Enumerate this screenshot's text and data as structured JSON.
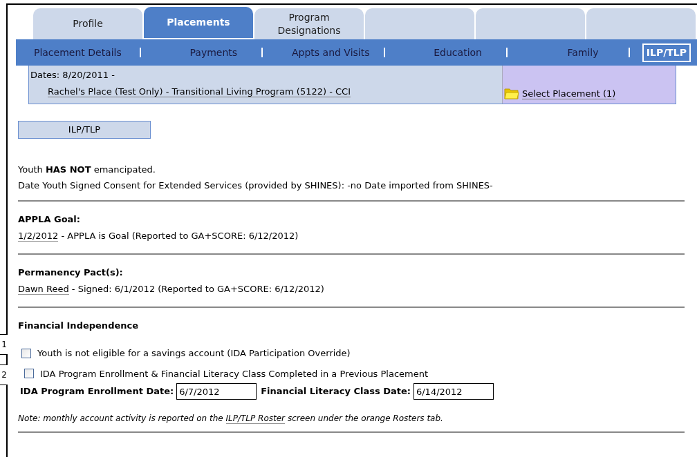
{
  "tabs": [
    {
      "label": "Profile",
      "selected": false
    },
    {
      "label": "Placements",
      "selected": true
    },
    {
      "label": "Program Designations",
      "selected": false
    },
    {
      "selected": false
    },
    {
      "selected": false
    },
    {
      "selected": false
    }
  ],
  "subnav": [
    {
      "label": "Placement Details",
      "selected": false
    },
    {
      "label": "Payments",
      "selected": false
    },
    {
      "label": "Appts and Visits",
      "selected": false
    },
    {
      "label": "Education",
      "selected": false
    },
    {
      "label": "Family",
      "selected": false
    },
    {
      "label": "ILP/TLP",
      "selected": true
    }
  ],
  "placement": {
    "dates": "Dates: 8/20/2011 -",
    "name": "Rachel's Place (Test Only) - Transitional Living Program (5122) - CCI",
    "select_link": "Select Placement (1)"
  },
  "section_button": "ILP/TLP",
  "emancipation": "Youth **HAS NOT** emancipated.",
  "consent": "Date Youth Signed Consent for Extended Services (provided by SHINES): -no Date imported from SHINES-",
  "appla": {
    "heading": "APPLA Goal:",
    "link": "1/2/2012",
    "text": " - APPLA is Goal (Reported to GA+SCORE: 6/12/2012)"
  },
  "pact": {
    "heading": "Permanency Pact(s):",
    "link": "Dawn Reed",
    "text": " - Signed: 6/1/2012 (Reported to GA+SCORE: 6/12/2012)"
  },
  "financial": {
    "heading": "Financial Independence",
    "checkboxes": [
      {
        "label": "Youth is not eligible for a savings account (IDA Participation Override)",
        "checked": false,
        "marker": "1"
      },
      {
        "label": "IDA Program Enrollment & Financial Literacy Class Completed in a Previous Placement",
        "checked": false,
        "marker": "2"
      }
    ],
    "fields": [
      {
        "label": "IDA Program Enrollment Date:",
        "value": "6/7/2012"
      },
      {
        "label": "Financial Literacy Class Date:",
        "value": "6/14/2012"
      }
    ],
    "note_before": "Note: monthly account activity is reported on the ",
    "note_link": "ILP/TLP Roster",
    "note_after": " screen under the orange Rosters tab."
  }
}
